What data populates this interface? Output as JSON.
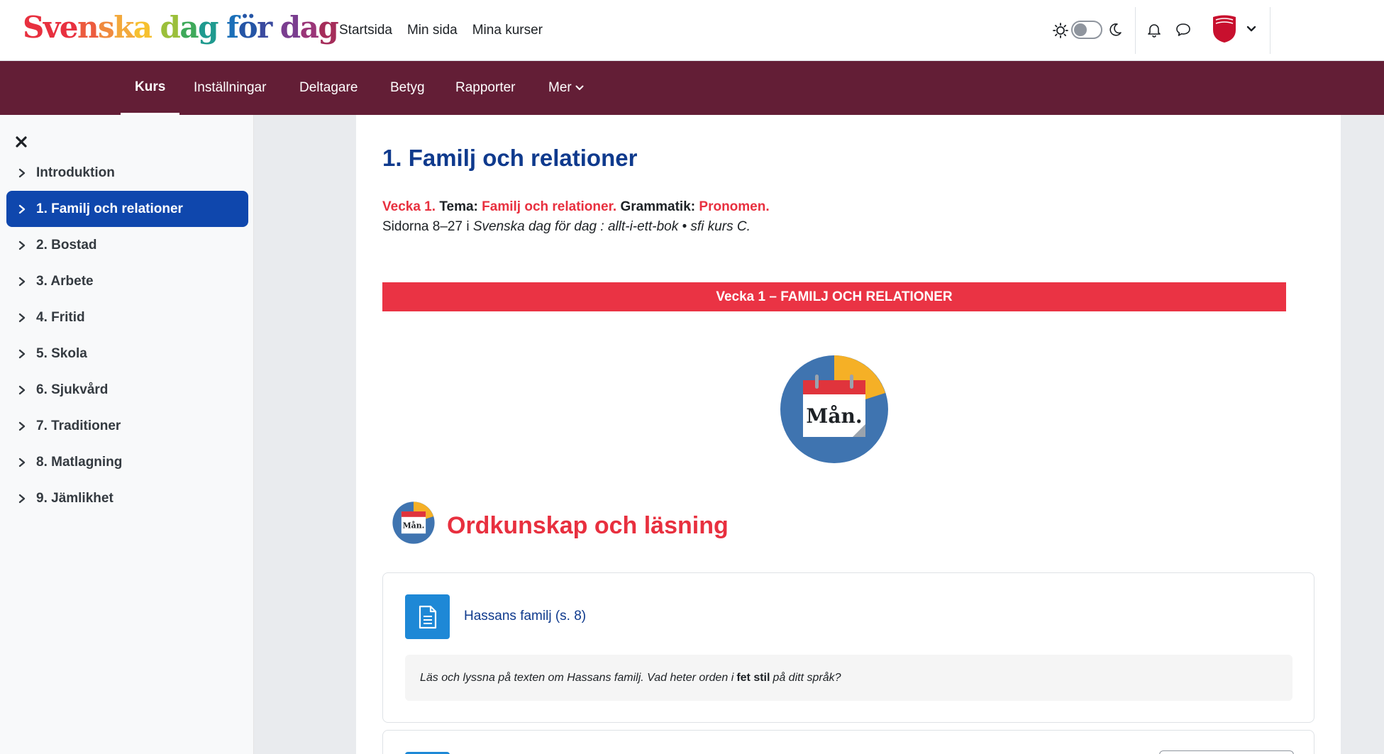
{
  "brand": {
    "letters": [
      {
        "ch": "S",
        "color": "#e8303f"
      },
      {
        "ch": "v",
        "color": "#e8303f"
      },
      {
        "ch": "e",
        "color": "#e8303f"
      },
      {
        "ch": "n",
        "color": "#ec5b3e"
      },
      {
        "ch": "s",
        "color": "#f08a3e"
      },
      {
        "ch": "k",
        "color": "#f3a93c"
      },
      {
        "ch": "a",
        "color": "#f6c02f"
      },
      {
        "ch": " ",
        "color": "#ffffff"
      },
      {
        "ch": "d",
        "color": "#9bbf3a"
      },
      {
        "ch": "a",
        "color": "#3ea95a"
      },
      {
        "ch": "g",
        "color": "#1f9a8f"
      },
      {
        "ch": " ",
        "color": "#ffffff"
      },
      {
        "ch": "f",
        "color": "#1b6fb8"
      },
      {
        "ch": "ö",
        "color": "#2555a6"
      },
      {
        "ch": "r",
        "color": "#3a4a9f"
      },
      {
        "ch": " ",
        "color": "#ffffff"
      },
      {
        "ch": "d",
        "color": "#7a3d8f"
      },
      {
        "ch": "a",
        "color": "#9a3578"
      },
      {
        "ch": "g",
        "color": "#a52d5a"
      }
    ]
  },
  "topnav": [
    "Startsida",
    "Min sida",
    "Mina kurser"
  ],
  "icons": {
    "theme_light": "sun-icon",
    "theme_dark": "moon-icon",
    "notifications": "bell-icon",
    "messages": "chat-icon",
    "user": "avatar-icon",
    "close": "close-icon",
    "chevron": "chevron-right-icon",
    "activity": "document-icon",
    "section": "calendar-icon"
  },
  "colors": {
    "secnav_bg": "#631e36",
    "active_nav": "#0f47ad",
    "heading_blue": "#0f3a8d",
    "accent_red": "#e8303f",
    "banner_red": "#ea3344",
    "activity_blue": "#1e88d6"
  },
  "secnav": {
    "items": [
      "Kurs",
      "Inställningar",
      "Deltagare",
      "Betyg",
      "Rapporter",
      "Mer"
    ],
    "active": "Kurs"
  },
  "drawer": {
    "items": [
      "Introduktion",
      "1. Familj och relationer",
      "2. Bostad",
      "3. Arbete",
      "4. Fritid",
      "5. Skola",
      "6. Sjukvård",
      "7. Traditioner",
      "8. Matlagning",
      "9. Jämlikhet"
    ],
    "active_index": 1
  },
  "main": {
    "title": "1. Familj och relationer",
    "intro": {
      "week": "Vecka 1.",
      "tema_label": "Tema:",
      "tema_value": "Familj och relationer.",
      "grammar_label": "Grammatik:",
      "grammar_value": "Pronomen.",
      "pages_prefix": "Sidorna 8–27 i",
      "book_title": "Svenska dag för dag : allt-i-ett-bok • sfi kurs C."
    },
    "banner": "Vecka 1 – FAMILJ OCH RELATIONER",
    "calendar_icon_text": "Mån.",
    "section_title": "Ordkunskap och läsning",
    "activity": {
      "title": "Hassans familj (s. 8)",
      "desc_before": "Läs och lyssna på texten om Hassans familj. Vad heter orden i",
      "desc_bold": "fet stil",
      "desc_after": "på ditt språk?"
    }
  }
}
